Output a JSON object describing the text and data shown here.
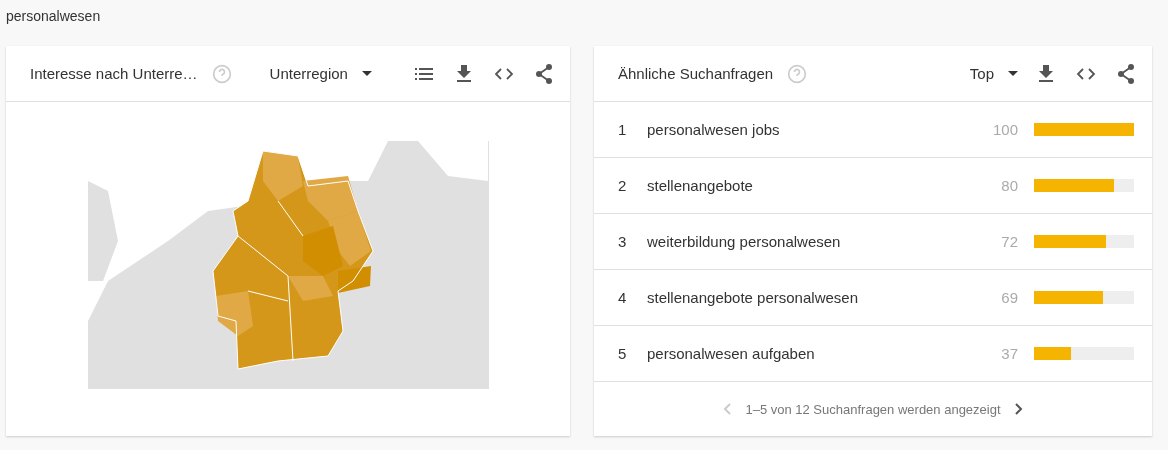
{
  "page_title": "personalwesen",
  "region_card": {
    "title": "Interesse nach Unterre…",
    "dropdown": "Unterregion"
  },
  "queries_card": {
    "title": "Ähnliche Suchanfragen",
    "dropdown": "Top",
    "rows": [
      {
        "rank": "1",
        "query": "personalwesen jobs",
        "value": "100",
        "level": 1.0
      },
      {
        "rank": "2",
        "query": "stellenangebote",
        "value": "80",
        "level": 0.8
      },
      {
        "rank": "3",
        "query": "weiterbildung personalwesen",
        "value": "72",
        "level": 0.72
      },
      {
        "rank": "4",
        "query": "stellenangebote personalwesen",
        "value": "69",
        "level": 0.69
      },
      {
        "rank": "5",
        "query": "personalwesen aufgaben",
        "value": "37",
        "level": 0.37
      }
    ],
    "pager": {
      "text": "1–5 von 12 Suchanfragen werden angezeigt",
      "prev_disabled": true,
      "next_disabled": false
    }
  }
}
